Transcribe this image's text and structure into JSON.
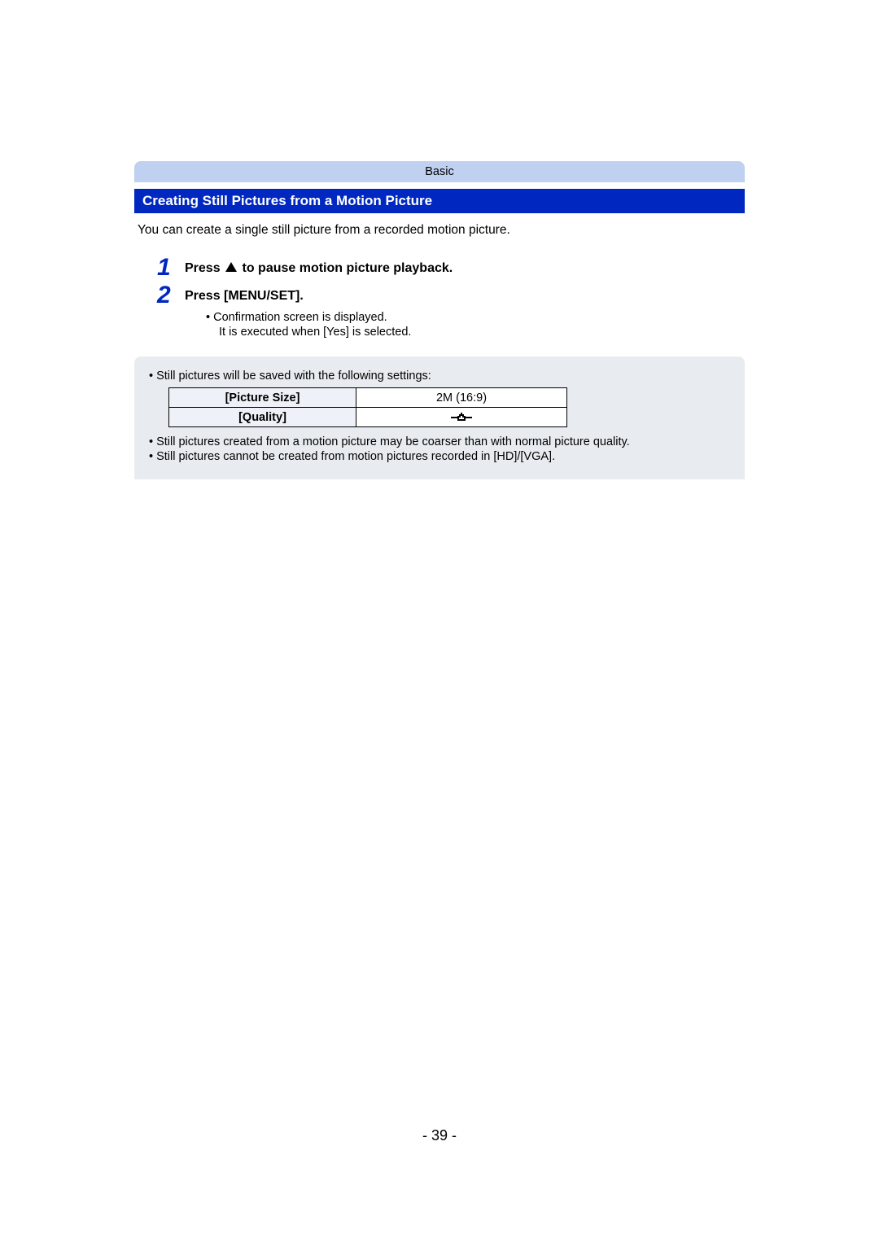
{
  "chapter": "Basic",
  "section_title": "Creating Still Pictures from a Motion Picture",
  "intro": "You can create a single still picture from a recorded motion picture.",
  "steps": [
    {
      "num": "1",
      "text_pre": "Press ",
      "text_post": " to pause motion picture playback.",
      "has_triangle": true
    },
    {
      "num": "2",
      "text_pre": "Press [MENU/SET].",
      "text_post": "",
      "has_triangle": false
    }
  ],
  "sub_notes": [
    "• Confirmation screen is displayed.",
    "It is executed when [Yes] is selected."
  ],
  "notebox_intro": "• Still pictures will be saved with the following settings:",
  "spec_table": [
    {
      "label": "[Picture Size]",
      "value": "2M (16:9)"
    },
    {
      "label": "[Quality]",
      "value_is_icon": true
    }
  ],
  "notebox_after": [
    "• Still pictures created from a motion picture may be coarser than with normal picture quality.",
    "• Still pictures cannot be created from motion pictures recorded in [HD]/[VGA]."
  ],
  "page_number": "- 39 -"
}
